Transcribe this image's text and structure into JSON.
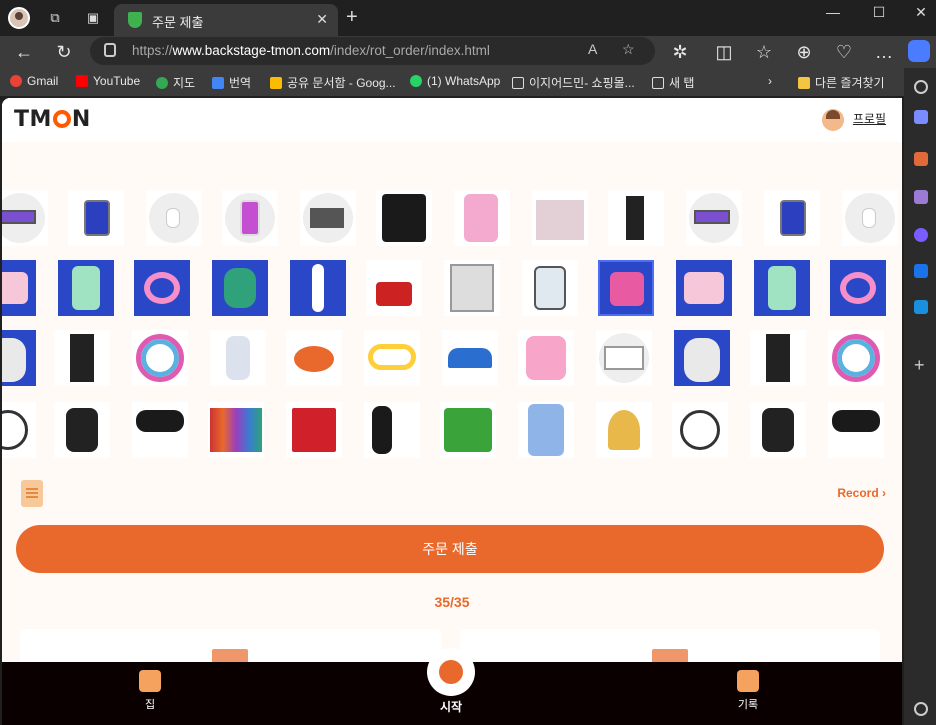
{
  "browser": {
    "tab_title": "주문 제출",
    "url_prefix": "https://",
    "url_domain": "www.backstage-tmon.com",
    "url_path": "/index/rot_order/index.html",
    "bookmarks": [
      "Gmail",
      "YouTube",
      "지도",
      "번역",
      "공유 문서함 - Goog...",
      "(1) WhatsApp",
      "이지어드민- 쇼핑몰...",
      "새 탭",
      "다른 즐겨찾기"
    ]
  },
  "header": {
    "logo": "TMON",
    "profile_label": "프로필"
  },
  "products": {
    "row1": [
      "laptop",
      "tablet",
      "earbuds",
      "phone",
      "tablet-stand",
      "ice-maker",
      "hair-dryer-pink",
      "storage-box",
      "desktop-pc",
      "laptop",
      "tablet",
      "earbuds"
    ],
    "row2": [
      "lunchbox",
      "toy-phone",
      "cat-headphones",
      "owl-backpack",
      "hydration-pack",
      "mop-bucket",
      "scale",
      "kettle",
      "kids-toy",
      "lunchbox",
      "toy-phone",
      "cat-headphones"
    ],
    "row3": [
      "koala-plush",
      "desktop-pc",
      "baby-ball",
      "baby-cup",
      "crab-toy",
      "teether",
      "steam-iron",
      "toy-set-pink",
      "tv",
      "koala-plush",
      "desktop-pc",
      "baby-ball"
    ],
    "row4": [
      "baby-bouncer",
      "air-fryer",
      "hair-dryer",
      "nail-polish-set",
      "game-console",
      "guitar",
      "plush-box",
      "phone-case",
      "sensory-toy",
      "baby-bouncer",
      "air-fryer",
      "hair-dryer"
    ]
  },
  "record": {
    "link_label": "Record ›"
  },
  "submit_button_label": "주문 제출",
  "counter": "35/35",
  "bottom_nav": {
    "home_label": "집",
    "start_label": "시작",
    "history_label": "기록"
  },
  "colors": {
    "accent": "#e8692b",
    "brand_o": "#ff5a00",
    "bottom_nav_bg": "#0b0000",
    "page_bg": "#fffaf5"
  }
}
